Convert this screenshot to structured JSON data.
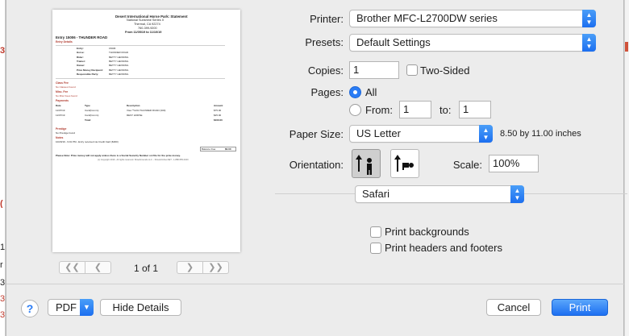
{
  "printer": {
    "label": "Printer:",
    "value": "Brother MFC-L2700DW series"
  },
  "presets": {
    "label": "Presets:",
    "value": "Default Settings"
  },
  "copies": {
    "label": "Copies:",
    "value": "1",
    "two_sided_label": "Two-Sided"
  },
  "pages": {
    "label": "Pages:",
    "all_label": "All",
    "from_label": "From:",
    "from_value": "1",
    "to_label": "to:",
    "to_value": "1"
  },
  "paper_size": {
    "label": "Paper Size:",
    "value": "US Letter",
    "dimensions": "8.50 by 11.00 inches"
  },
  "orientation": {
    "label": "Orientation:",
    "selected": "portrait"
  },
  "scale": {
    "label": "Scale:",
    "value": "100%"
  },
  "app_menu": {
    "value": "Safari"
  },
  "options": {
    "print_backgrounds": "Print backgrounds",
    "print_headers_footers": "Print headers and footers"
  },
  "preview": {
    "page_indicator": "1 of 1",
    "doc": {
      "title": "Desert International Horse Park: Statement",
      "line2": "National Sunshine Series II",
      "line3": "Thermal, CA 92274",
      "phone": "760-399-9200",
      "dates": "From 11/05/19 to 11/10/19",
      "entry": "Entry 15006 - THUNDER ROAD",
      "section_details": "Entry Details",
      "field_labels": [
        "Entry:",
        "Horse:",
        "Rider:",
        "Trainer:",
        "Owner:",
        "Prize Money Recipient:",
        "Responsible Party:"
      ],
      "field_values": [
        "15006",
        "THUNDER ROAD",
        "BETTY HENNING",
        "BETTY HENNING",
        "BETTY HENNING",
        "BETTY HENNING",
        "BETTY HENNING"
      ],
      "section_classes": "Class Fee",
      "classes_note": "No Classes Found",
      "section_misc": "Misc. Fee",
      "misc_note": "No Misc Fees found",
      "section_payments": "Payments",
      "pay_headers": [
        "Date",
        "Type",
        "Description",
        "Amount"
      ],
      "pay_rows": [
        [
          "11/07/19",
          "Card(Comm)",
          "Visa **1234 THUNDER ROAD (300)",
          "$75.00"
        ],
        [
          "11/07/19",
          "Card(Comm)",
          "REST HORSE",
          "$25.00"
        ]
      ],
      "total_label": "Total:",
      "total_value": "$100.00",
      "section_prestige": "Prestige",
      "prestige_note": "No Prestige found",
      "section_notes": "Notes",
      "notes_text": "10/29/19 - 9:01 PM - Entry received via Credit Card ($300)",
      "balance_label": "Balance Due:",
      "balance_value": "$0.00",
      "footer_note": "Please Note: Prize money will not apply unless there is a Social Security Number on File for the prize money.",
      "copyright": "(c) Copyright 2019 - All rights reserved. ShowGrounds LLC. - ShowsOnline.NET - 1-888-555-0100"
    }
  },
  "bottom": {
    "help": "?",
    "pdf_label": "PDF",
    "hide_details": "Hide Details",
    "cancel": "Cancel",
    "print": "Print"
  },
  "colors": {
    "accent": "#2a7cf5",
    "doc_red": "#b03a2e"
  }
}
